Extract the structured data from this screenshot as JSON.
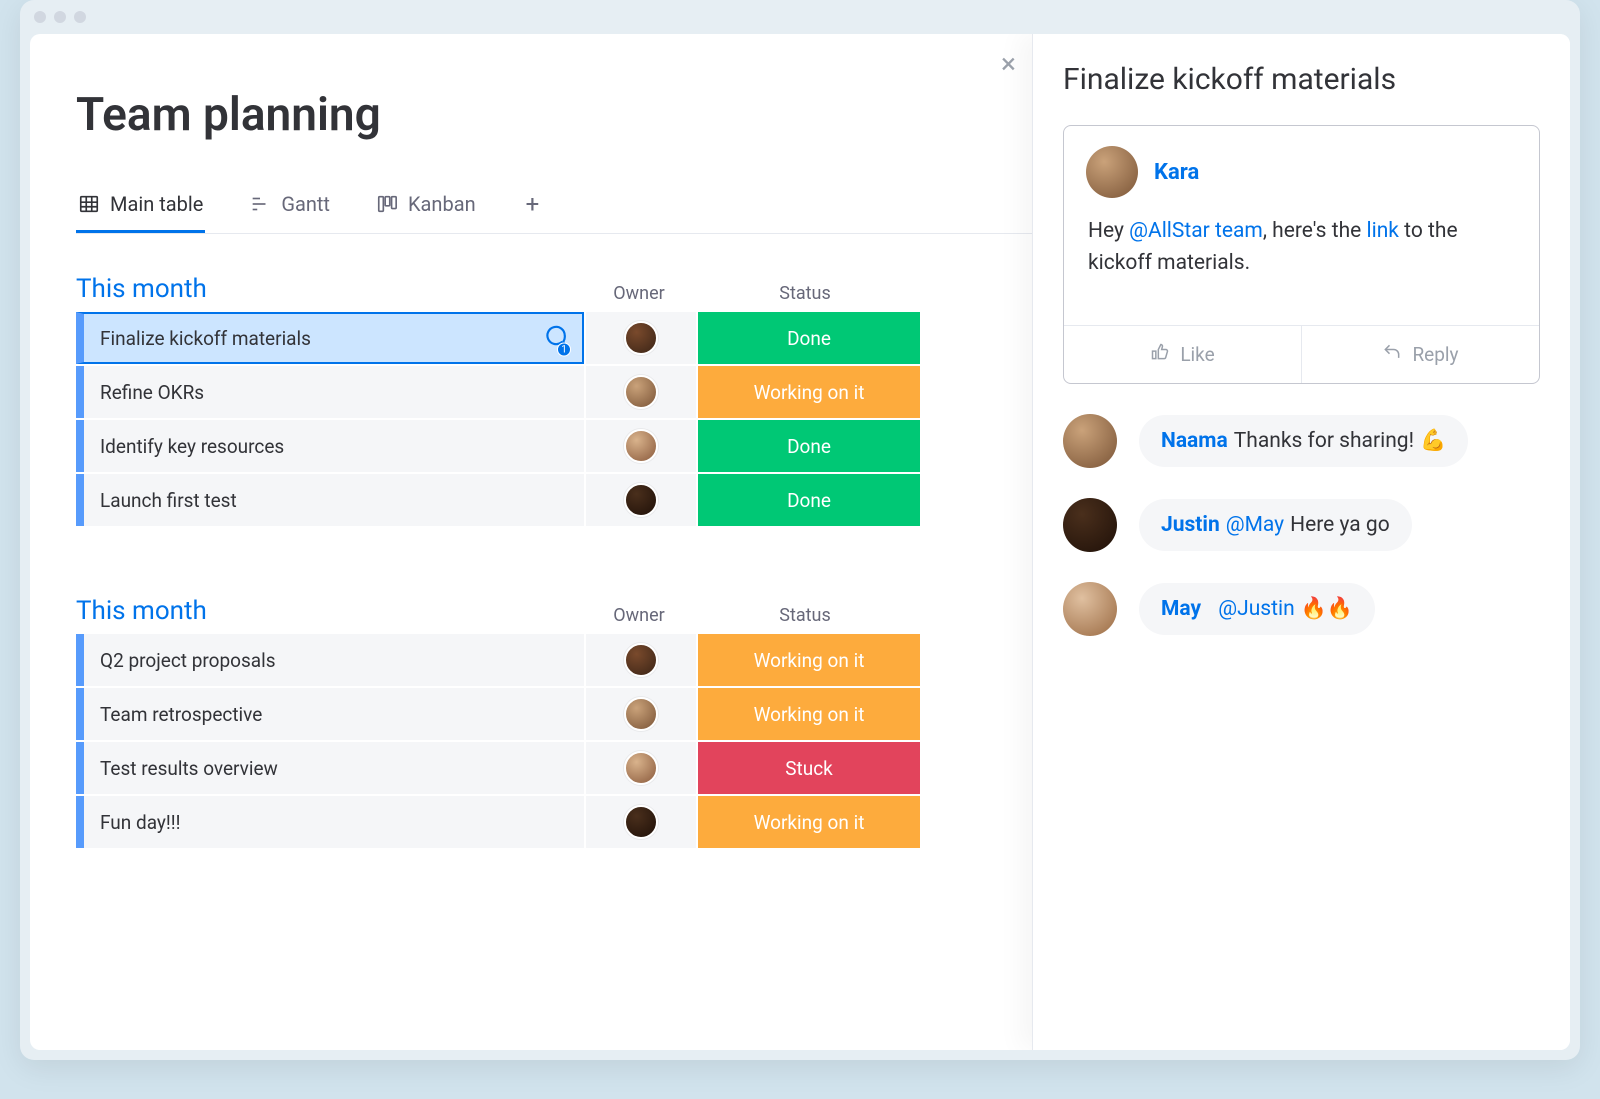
{
  "page": {
    "title": "Team planning"
  },
  "tabs": [
    {
      "label": "Main table",
      "icon": "table"
    },
    {
      "label": "Gantt",
      "icon": "gantt"
    },
    {
      "label": "Kanban",
      "icon": "kanban"
    }
  ],
  "columns": {
    "owner": "Owner",
    "status": "Status"
  },
  "status_colors": {
    "Done": "#00c875",
    "Working on it": "#fdab3d",
    "Stuck": "#e2445c"
  },
  "groups": [
    {
      "title": "This month",
      "rows": [
        {
          "name": "Finalize kickoff materials",
          "owner_avatar": "avatar-color-1",
          "status": "Done",
          "selected": true,
          "comments": 1
        },
        {
          "name": "Refine OKRs",
          "owner_avatar": "avatar-color-2",
          "status": "Working on it"
        },
        {
          "name": "Identify key resources",
          "owner_avatar": "avatar-color-3",
          "status": "Done"
        },
        {
          "name": "Launch first test",
          "owner_avatar": "avatar-color-4",
          "status": "Done"
        }
      ]
    },
    {
      "title": "This month",
      "rows": [
        {
          "name": "Q2 project proposals",
          "owner_avatar": "avatar-color-1",
          "status": "Working on it"
        },
        {
          "name": "Team retrospective",
          "owner_avatar": "avatar-color-2",
          "status": "Working on it"
        },
        {
          "name": "Test results overview",
          "owner_avatar": "avatar-color-3",
          "status": "Stuck"
        },
        {
          "name": "Fun day!!!",
          "owner_avatar": "avatar-color-4",
          "status": "Working on it"
        }
      ]
    }
  ],
  "side": {
    "title": "Finalize kickoff materials",
    "comment": {
      "author": "Kara",
      "avatar": "avatar-color-2",
      "body_pre": "Hey ",
      "body_mention": "@AllStar team",
      "body_mid": ", here's the ",
      "body_link": "link",
      "body_post": " to the kickoff materials.",
      "like_label": "Like",
      "reply_label": "Reply"
    },
    "replies": [
      {
        "author": "Naama",
        "avatar": "avatar-color-2",
        "text": "Thanks for sharing!",
        "emoji": "💪"
      },
      {
        "author": "Justin",
        "avatar": "avatar-color-4",
        "mention": "@May",
        "text": "Here ya go"
      },
      {
        "author": "May",
        "avatar": "avatar-color-5",
        "mention": "@Justin",
        "emoji": "🔥🔥"
      }
    ]
  }
}
